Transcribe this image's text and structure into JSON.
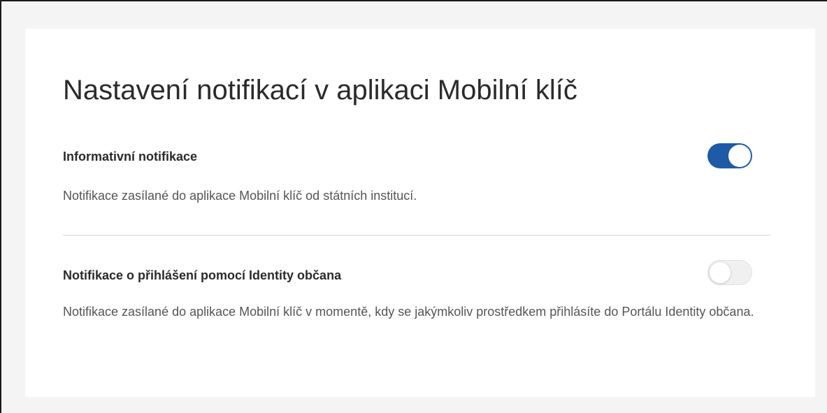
{
  "page": {
    "title": "Nastavení notifikací v aplikaci Mobilní klíč"
  },
  "settings": [
    {
      "title": "Informativní notifikace",
      "description": "Notifikace zasílané do aplikace Mobilní klíč od státních institucí.",
      "enabled": true
    },
    {
      "title": "Notifikace o přihlášení pomocí Identity občana",
      "description": "Notifikace zasílané do aplikace Mobilní klíč v momentě, kdy se jakýmkoliv prostředkem přihlásíte do Portálu Identity občana.",
      "enabled": false
    }
  ],
  "colors": {
    "toggle_on": "#1f5aa6",
    "toggle_off": "#f0f0f0",
    "card_background": "#ffffff",
    "page_background": "#f4f4f4"
  }
}
